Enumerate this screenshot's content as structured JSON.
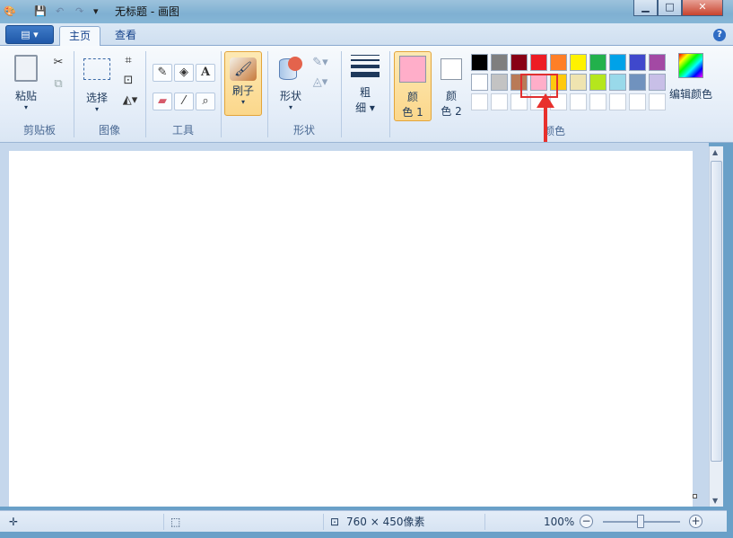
{
  "window": {
    "title": "无标题 - 画图",
    "buttons": {
      "minimize": "▁",
      "maximize": "□",
      "close": "✕"
    }
  },
  "quick_access": {
    "icons": [
      "paint-app-icon",
      "save-icon",
      "undo-icon",
      "redo-icon",
      "customize-icon"
    ]
  },
  "tabs": {
    "home": "主页",
    "view": "查看"
  },
  "ribbon": {
    "clipboard": {
      "paste": "粘贴",
      "group": "剪贴板"
    },
    "image": {
      "select": "选择",
      "group": "图像"
    },
    "tools": {
      "group": "工具"
    },
    "brushes": {
      "label": "刷子"
    },
    "shapes": {
      "label": "形状",
      "group": "形状"
    },
    "size": {
      "line1": "粗",
      "line2": "细"
    },
    "colors": {
      "color1_line1": "颜",
      "color1_line2": "色 1",
      "color2_line1": "颜",
      "color2_line2": "色 2",
      "group": "颜色",
      "edit": "编辑颜色",
      "color1_value": "#ffaec9",
      "color2_value": "#ffffff",
      "palette_row1": [
        "#000000",
        "#7f7f7f",
        "#880015",
        "#ed1c24",
        "#ff7f27",
        "#fff200",
        "#22b14c",
        "#00a2e8",
        "#3f48cc",
        "#a349a4"
      ],
      "palette_row2": [
        "#ffffff",
        "#c3c3c3",
        "#b97a57",
        "#ffaec9",
        "#ffc90e",
        "#efe4b0",
        "#b5e61d",
        "#99d9ea",
        "#7092be",
        "#c8bfe7"
      ],
      "palette_row3": [
        "#ffffff",
        "#ffffff",
        "#ffffff",
        "#ffffff",
        "#ffffff",
        "#ffffff",
        "#ffffff",
        "#ffffff",
        "#ffffff",
        "#ffffff"
      ]
    }
  },
  "status": {
    "dimensions": "760 × 450像素",
    "zoom": "100%"
  },
  "accent": {
    "annotation": "#e8302c",
    "selected_group": "#fbd78b"
  }
}
